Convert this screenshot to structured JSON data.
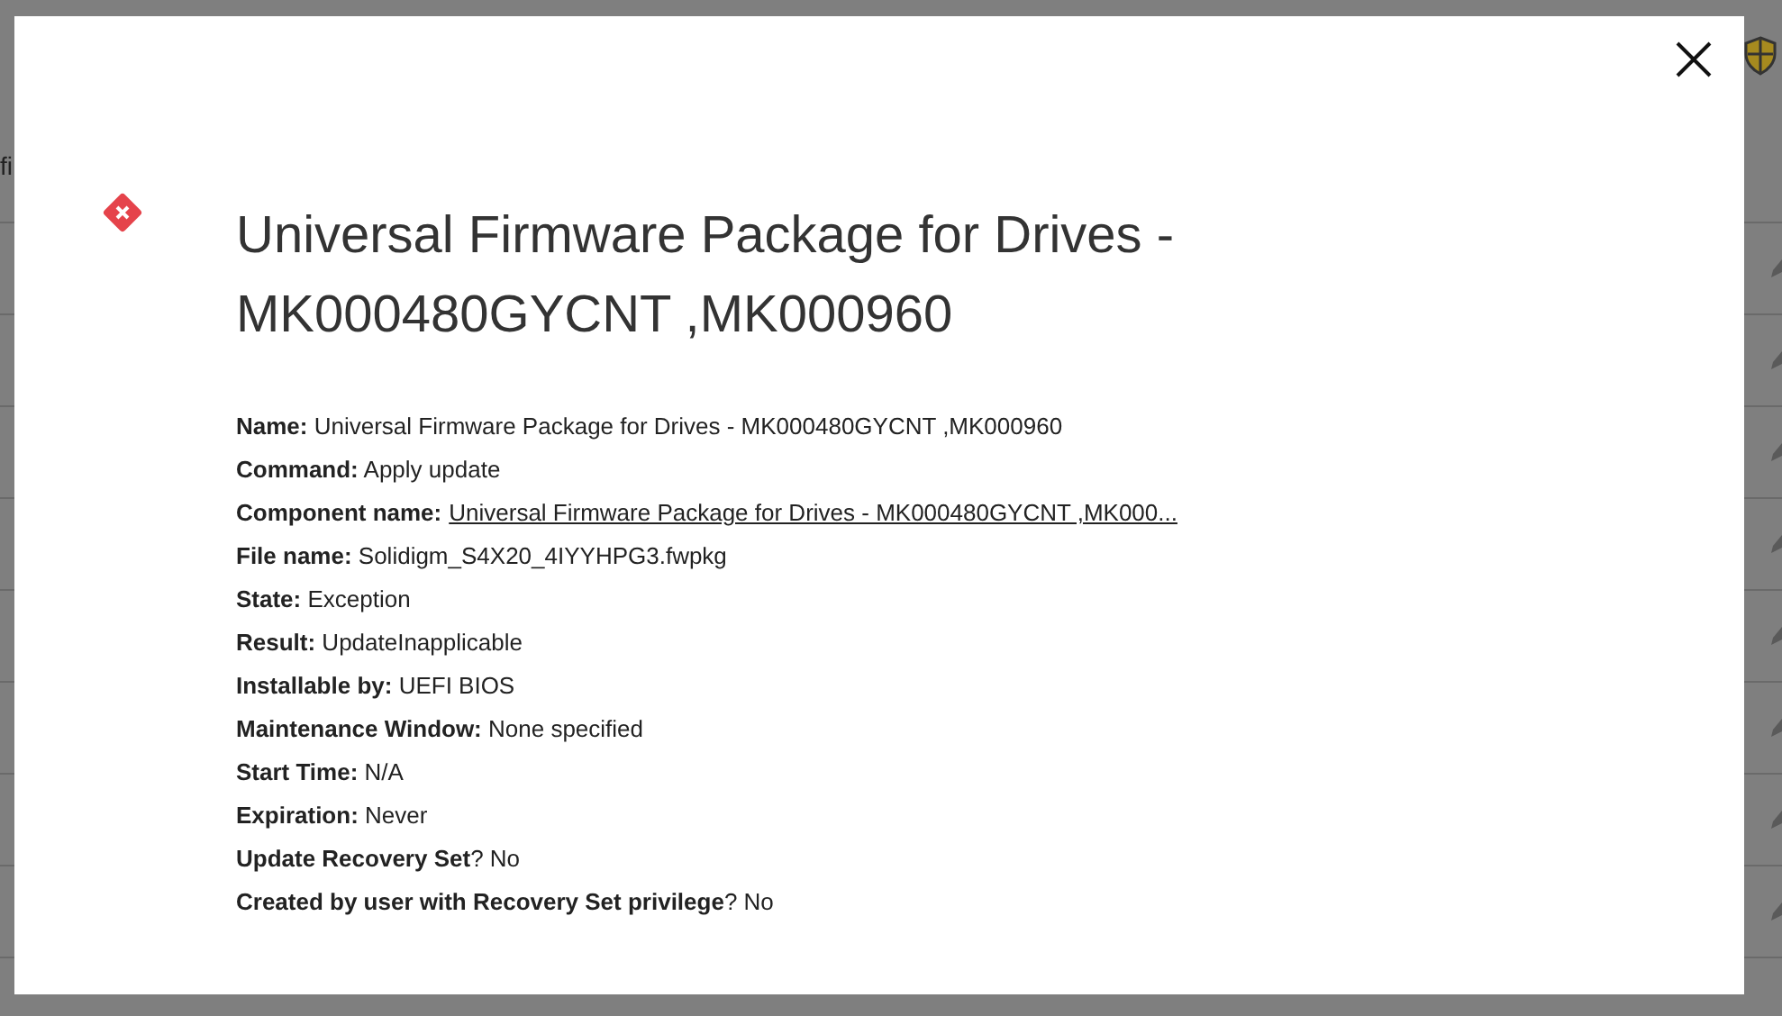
{
  "background": {
    "text_fragment": "fi"
  },
  "dialog": {
    "title": "Universal Firmware Package for Drives - MK000480GYCNT ,MK000960",
    "fields": [
      {
        "kind": "text",
        "text": "**Name:** Universal Firmware Package for Drives - MK000480GYCNT ,MK000960"
      },
      {
        "kind": "text",
        "text": "**Command:** Apply update"
      },
      {
        "kind": "link",
        "label": "Component name:",
        "value": "Universal Firmware Package for Drives - MK000480GYCNT ,MK000..."
      },
      {
        "kind": "text",
        "text": "**File name:** Solidigm_S4X20_4IYYHPG3.fwpkg"
      },
      {
        "kind": "text",
        "text": "**State:** Exception"
      },
      {
        "kind": "text",
        "text": "**Result:** UpdateInapplicable"
      },
      {
        "kind": "text",
        "text": "**Installable by:** UEFI BIOS"
      },
      {
        "kind": "text",
        "text": "**Maintenance Window:** None specified"
      },
      {
        "kind": "text",
        "text": "**Start Time:** N/A"
      },
      {
        "kind": "text",
        "text": "**Expiration:** Never"
      },
      {
        "kind": "text",
        "text": "**Update Recovery Set**? No"
      },
      {
        "kind": "text",
        "text": "**Created by user with Recovery Set privilege**? No"
      }
    ]
  }
}
